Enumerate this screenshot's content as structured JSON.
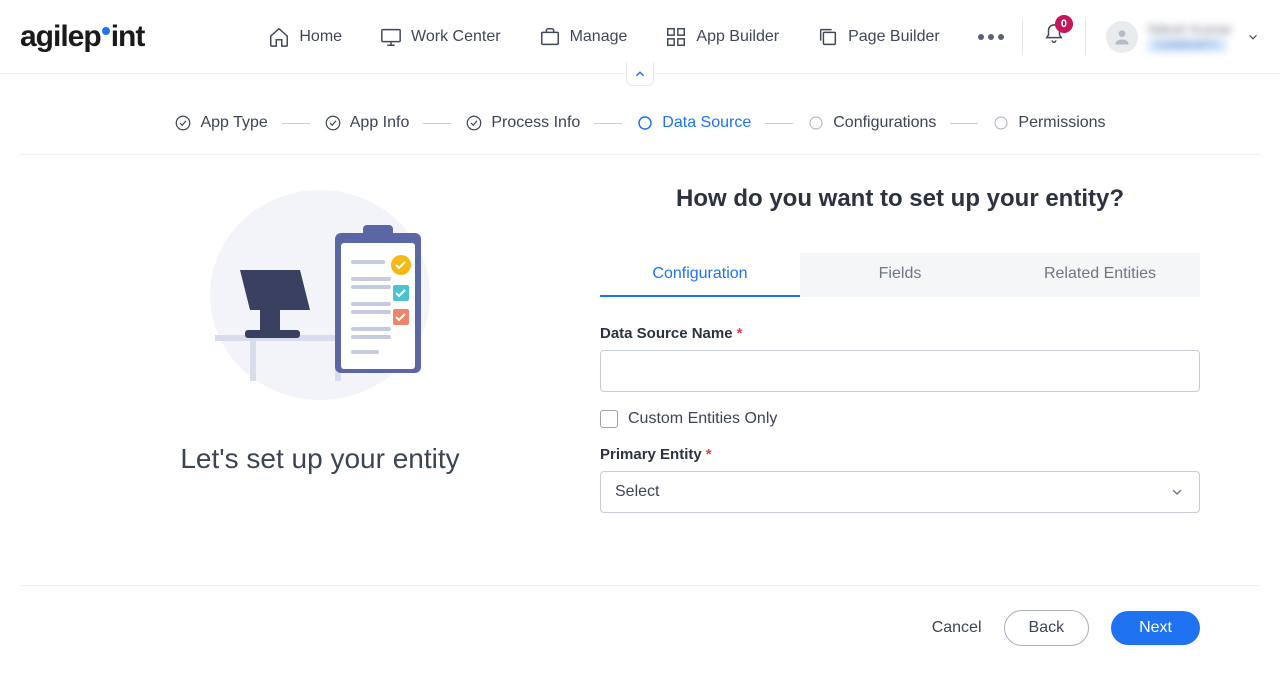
{
  "logoText": {
    "pre": "agilep",
    "post": "int"
  },
  "nav": {
    "home": "Home",
    "work": "Work Center",
    "manage": "Manage",
    "appbuilder": "App Builder",
    "pagebuilder": "Page Builder"
  },
  "notifications": {
    "count": "0"
  },
  "user": {
    "name": "Nilesh Kumar",
    "tag": "COMMUNITY"
  },
  "steps": {
    "appType": "App Type",
    "appInfo": "App Info",
    "processInfo": "Process Info",
    "dataSource": "Data Source",
    "configurations": "Configurations",
    "permissions": "Permissions"
  },
  "left": {
    "heading": "Let's set up your entity"
  },
  "right": {
    "heading": "How do you want to set up your entity?",
    "tabs": {
      "config": "Configuration",
      "fields": "Fields",
      "related": "Related Entities"
    },
    "labels": {
      "dsName": "Data Source Name",
      "customOnly": "Custom Entities Only",
      "primaryEntity": "Primary Entity"
    },
    "select": {
      "placeholder": "Select"
    }
  },
  "footer": {
    "cancel": "Cancel",
    "back": "Back",
    "next": "Next"
  }
}
